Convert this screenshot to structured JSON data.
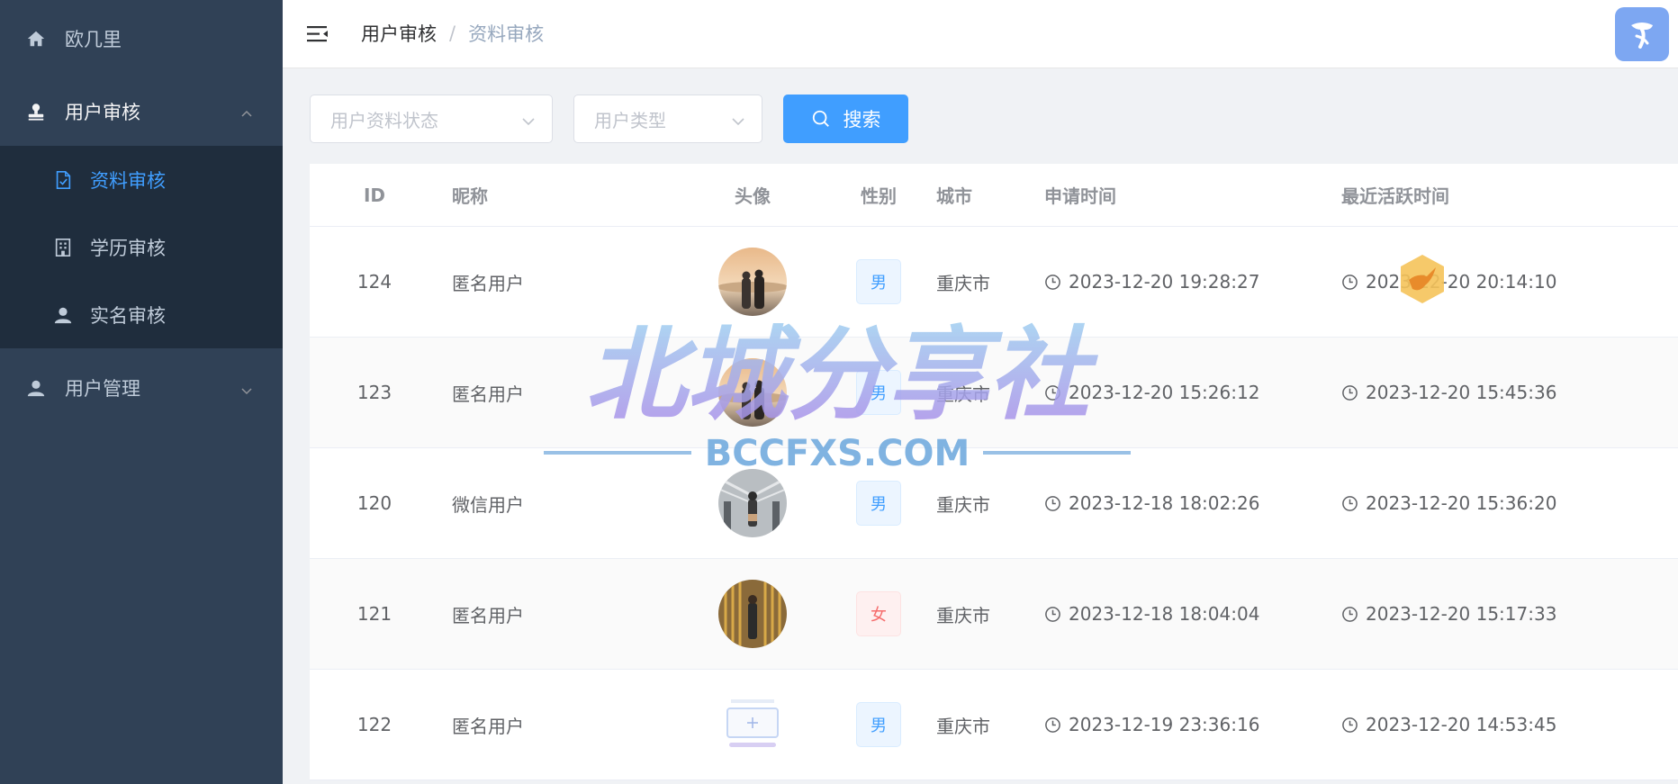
{
  "sidebar": {
    "home_label": "欧几里",
    "user_review_label": "用户审核",
    "sub_items": [
      {
        "label": "资料审核",
        "icon": "document-check-icon"
      },
      {
        "label": "学历审核",
        "icon": "building-icon"
      },
      {
        "label": "实名审核",
        "icon": "user-icon"
      }
    ],
    "user_manage_label": "用户管理"
  },
  "navbar": {
    "breadcrumb": [
      "用户审核",
      "资料审核"
    ],
    "separator": "/"
  },
  "filters": {
    "status_placeholder": "用户资料状态",
    "type_placeholder": "用户类型",
    "search_label": "搜索"
  },
  "table": {
    "headers": {
      "id": "ID",
      "name": "昵称",
      "avatar": "头像",
      "gender": "性别",
      "city": "城市",
      "apply_time": "申请时间",
      "active_time": "最近活跃时间"
    },
    "rows": [
      {
        "id": "124",
        "name": "匿名用户",
        "gender": "男",
        "city": "重庆市",
        "apply_time": "2023-12-20 19:28:27",
        "active_time": "2023-12-20 20:14:10"
      },
      {
        "id": "123",
        "name": "匿名用户",
        "gender": "男",
        "city": "重庆市",
        "apply_time": "2023-12-20 15:26:12",
        "active_time": "2023-12-20 15:45:36"
      },
      {
        "id": "120",
        "name": "微信用户",
        "gender": "男",
        "city": "重庆市",
        "apply_time": "2023-12-18 18:02:26",
        "active_time": "2023-12-20 15:36:20"
      },
      {
        "id": "121",
        "name": "匿名用户",
        "gender": "女",
        "city": "重庆市",
        "apply_time": "2023-12-18 18:04:04",
        "active_time": "2023-12-20 15:17:33"
      },
      {
        "id": "122",
        "name": "匿名用户",
        "gender": "男",
        "city": "重庆市",
        "apply_time": "2023-12-19 23:36:16",
        "active_time": "2023-12-20 14:53:45"
      }
    ]
  },
  "watermark": {
    "title": "北城分享社",
    "subtitle": "BCCFXS.COM"
  },
  "colors": {
    "sidebar_bg": "#304156",
    "submenu_bg": "#1f2d3d",
    "accent": "#409eff",
    "female": "#f56c6c"
  }
}
